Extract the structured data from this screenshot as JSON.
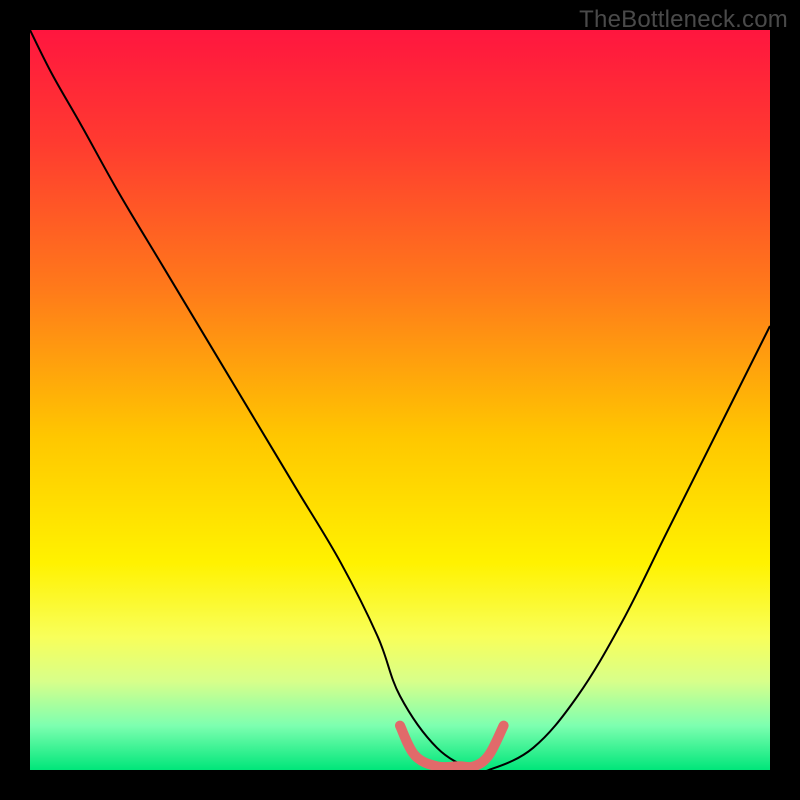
{
  "watermark": "TheBottleneck.com",
  "chart_data": {
    "type": "line",
    "title": "",
    "xlabel": "",
    "ylabel": "",
    "xlim": [
      0,
      100
    ],
    "ylim": [
      0,
      100
    ],
    "grid": false,
    "legend": false,
    "background_gradient_stops": [
      {
        "offset": 0.0,
        "color": "#ff163f"
      },
      {
        "offset": 0.15,
        "color": "#ff3a30"
      },
      {
        "offset": 0.35,
        "color": "#ff7a1a"
      },
      {
        "offset": 0.55,
        "color": "#ffc700"
      },
      {
        "offset": 0.72,
        "color": "#fff200"
      },
      {
        "offset": 0.82,
        "color": "#f8ff5a"
      },
      {
        "offset": 0.88,
        "color": "#d8ff8a"
      },
      {
        "offset": 0.94,
        "color": "#7dffb0"
      },
      {
        "offset": 1.0,
        "color": "#00e67a"
      }
    ],
    "series": [
      {
        "name": "bottleneck-curve",
        "color": "#000000",
        "width": 2,
        "x": [
          0,
          3,
          7,
          12,
          18,
          24,
          30,
          36,
          42,
          47,
          50,
          55,
          60,
          62,
          68,
          74,
          80,
          86,
          92,
          100
        ],
        "y": [
          100,
          94,
          87,
          78,
          68,
          58,
          48,
          38,
          28,
          18,
          10,
          3,
          0,
          0,
          3,
          10,
          20,
          32,
          44,
          60
        ]
      },
      {
        "name": "flat-segment",
        "color": "#e16a6a",
        "width": 10,
        "linecap": "round",
        "x": [
          50,
          52,
          55,
          58,
          60,
          62,
          64
        ],
        "y": [
          6,
          2,
          0.5,
          0.5,
          0.5,
          2,
          6
        ]
      }
    ]
  }
}
